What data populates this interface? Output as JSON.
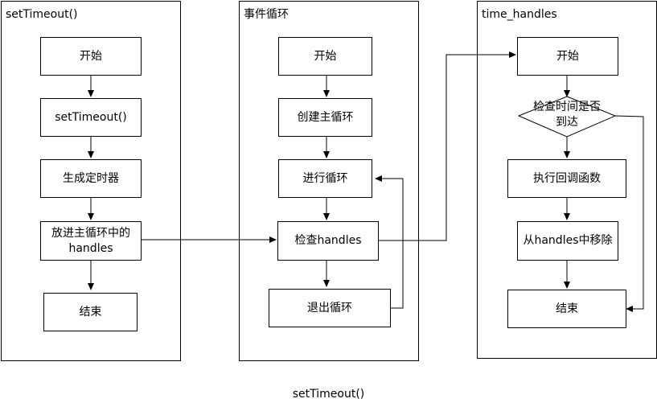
{
  "lanes": {
    "settimeout": {
      "title": "setTimeout()",
      "start": "开始",
      "call": "setTimeout()",
      "create_timer": "生成定时器",
      "put_handles": "放进主循环中的handles",
      "end": "结束"
    },
    "event_loop": {
      "title": "事件循环",
      "start": "开始",
      "create_loop": "创建主循环",
      "run_loop": "进行循环",
      "check_handles": "检查handles",
      "exit_loop": "退出循环"
    },
    "time_handles": {
      "title": "time_handles",
      "start": "开始",
      "check_time": "检查时间是否到达",
      "run_callback": "执行回调函数",
      "remove": "从handles中移除",
      "end": "结束"
    }
  },
  "caption": "setTimeout()"
}
